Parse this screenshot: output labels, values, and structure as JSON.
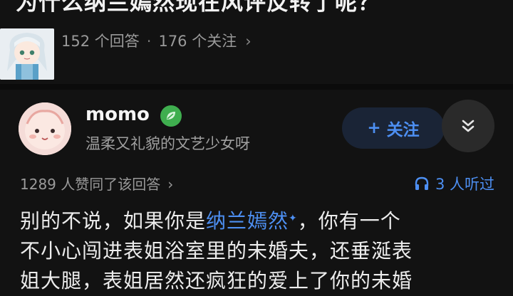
{
  "question": {
    "title": "为什么纳兰嫣然现在风评反转了呢？",
    "answer_count": "152 个回答",
    "follower_count": "176 个关注",
    "separator": "·",
    "stats_chevron": "›"
  },
  "answer": {
    "author": {
      "name": "momo",
      "bio": "温柔又礼貌的文艺少女呀"
    },
    "follow_label": "关注",
    "follow_prefix": "+",
    "likes_text": "1289 人赞同了该回答",
    "likes_chevron": "›",
    "listen_text": "3 人听过",
    "body": {
      "line1_before": "别的不说，如果你是",
      "line1_link": "纳兰嫣然",
      "line1_after": "，你有一个",
      "line2": "不小心闯进表姐浴室里的未婚夫，还垂涎表",
      "line3": "姐大腿，表姐居然还疯狂的爱上了你的未婚"
    }
  },
  "colors": {
    "background": "#121212",
    "accent_blue": "#4d8ff2",
    "badge_green": "#3fae4f"
  },
  "icons": {
    "badge": "leaf-badge-icon",
    "more": "double-chevron-down-icon",
    "listen": "headphones-icon"
  }
}
